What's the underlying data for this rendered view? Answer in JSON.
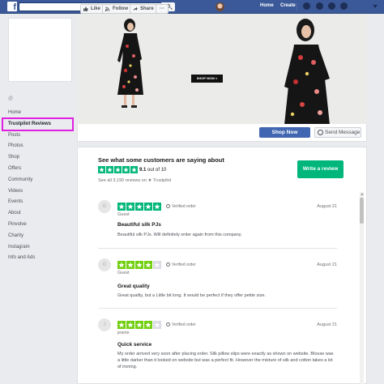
{
  "topbar": {
    "logo": "f",
    "nav": [
      "Home",
      "Create"
    ],
    "icons": [
      "search-icon",
      "friends-icon",
      "messenger-icon",
      "notifications-icon",
      "help-icon",
      "caret-icon"
    ]
  },
  "left": {
    "handle": "@",
    "nav": [
      "Home",
      "Trustpilot Reviews",
      "Posts",
      "Photos",
      "Shop",
      "Offers",
      "Community",
      "Videos",
      "Events",
      "About",
      "Pinvolve",
      "Charity",
      "Instagram",
      "Info and Ads"
    ],
    "active_index": 1
  },
  "cover": {
    "banner_button": "SHOP NOW >"
  },
  "actions": {
    "like": "Like",
    "follow": "Follow",
    "share": "Share",
    "more": "···",
    "shop_now": "Shop Now",
    "send_message": "Send Message"
  },
  "trustpilot": {
    "headline": "See what some customers are saying about",
    "score_value": "9.1",
    "score_suffix": "out of 10",
    "review_count_text": "See all 3,190 reviews on",
    "brand": "Trustpilot",
    "write_review": "Write a review",
    "accent": "#00b67a",
    "partial_star": "#73cf11"
  },
  "reviews": [
    {
      "initial": "G",
      "stars": 5,
      "verified": "Verified order",
      "date": "August 21",
      "name": "Guest",
      "title": "Beautiful silk PJs",
      "body": "Beautiful silk PJs. Will definitely order again from this company."
    },
    {
      "initial": "G",
      "stars": 4,
      "verified": "Verified order",
      "date": "August 21",
      "name": "Guest",
      "title": "Great quality",
      "body": "Great quality, but a Little bit long. It would be perfect if they offer petite size."
    },
    {
      "initial": "J",
      "stars": 4,
      "verified": "Verified order",
      "date": "August 21",
      "name": "jeanie",
      "title": "Quick service",
      "body": "My order arrived very soon after placing order. Silk pillow slips were exactly as shown on website. Blouse was a little darker than it looked on website but was a perfect fit. However the mixture of silk and cotton takes a lot of ironing."
    }
  ]
}
